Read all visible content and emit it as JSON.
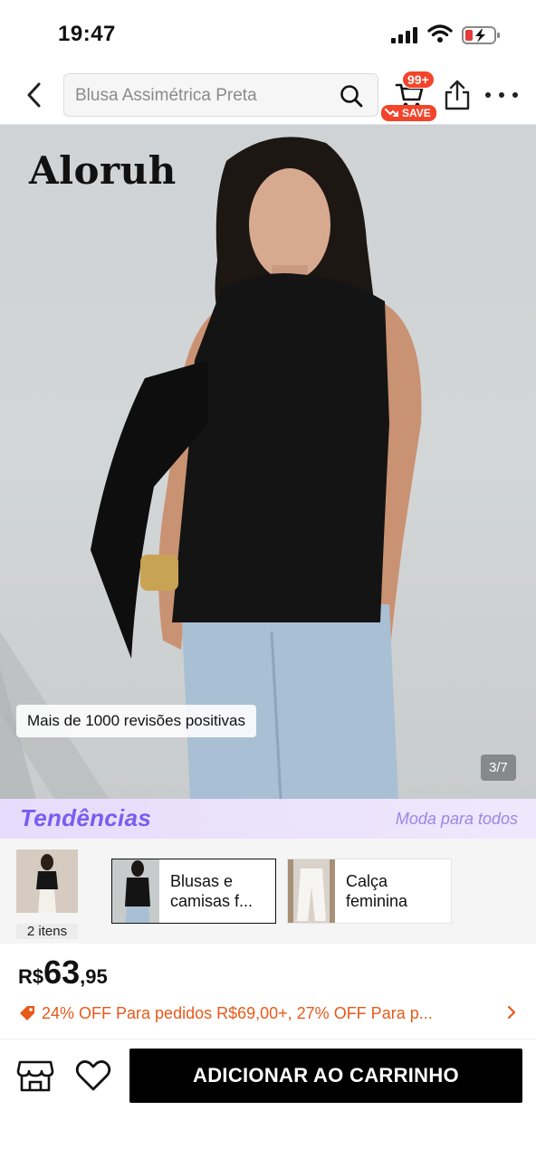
{
  "status_bar": {
    "time": "19:47"
  },
  "nav": {
    "search_placeholder": "Blusa Assimétrica Preta",
    "cart_badge": "99+",
    "save_badge": "SAVE"
  },
  "product": {
    "brand": "Aloruh",
    "reviews_chip": "Mais de 1000 revisões positivas",
    "image_counter": "3/7"
  },
  "trends": {
    "title": "Tendências",
    "subtitle": "Moda para todos",
    "outfit_count": "2 itens",
    "items": [
      {
        "label": "Blusas e camisas f..."
      },
      {
        "label": "Calça feminina"
      }
    ]
  },
  "price": {
    "currency": "R$",
    "main": "63",
    "cents": ",95"
  },
  "promo": {
    "text": "24% OFF Para pedidos R$69,00+,  27% OFF Para p..."
  },
  "actions": {
    "add_to_cart": "ADICIONAR AO CARRINHO"
  },
  "colors": {
    "accent": "#f3442a",
    "promo": "#e85a1a",
    "trends_purple": "#7a5cf0",
    "button_bg": "#000000"
  }
}
